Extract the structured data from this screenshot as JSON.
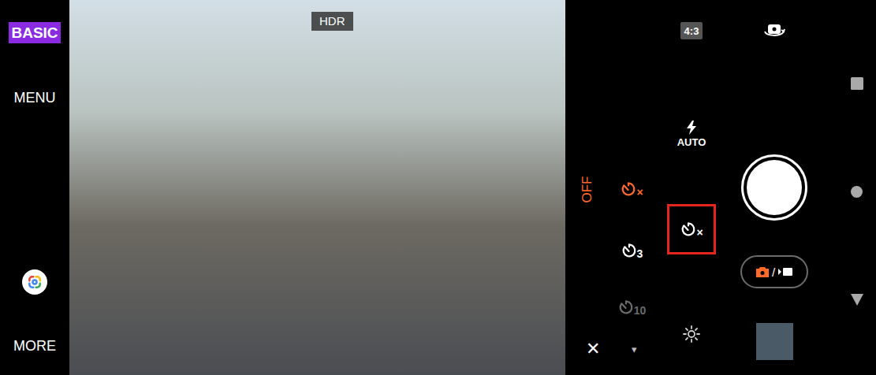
{
  "left_bar": {
    "badge": "BASIC",
    "menu": "MENU",
    "more": "MORE"
  },
  "viewfinder": {
    "hdr": "HDR"
  },
  "top_controls": {
    "aspect_ratio": "4:3"
  },
  "flash": {
    "label": "AUTO"
  },
  "timer_popup": {
    "off_label": "OFF",
    "options": [
      {
        "mark": "×",
        "selected": true,
        "disabled": false
      },
      {
        "mark": "3",
        "selected": false,
        "disabled": false
      },
      {
        "mark": "10",
        "selected": false,
        "disabled": true
      }
    ],
    "close": "✕",
    "expand": "▾"
  },
  "current_timer": {
    "mark": "×",
    "highlighted": true
  },
  "mode_toggle": {
    "separator": "/",
    "modes": [
      {
        "kind": "photo",
        "selected": true
      },
      {
        "kind": "video",
        "selected": false
      }
    ]
  }
}
